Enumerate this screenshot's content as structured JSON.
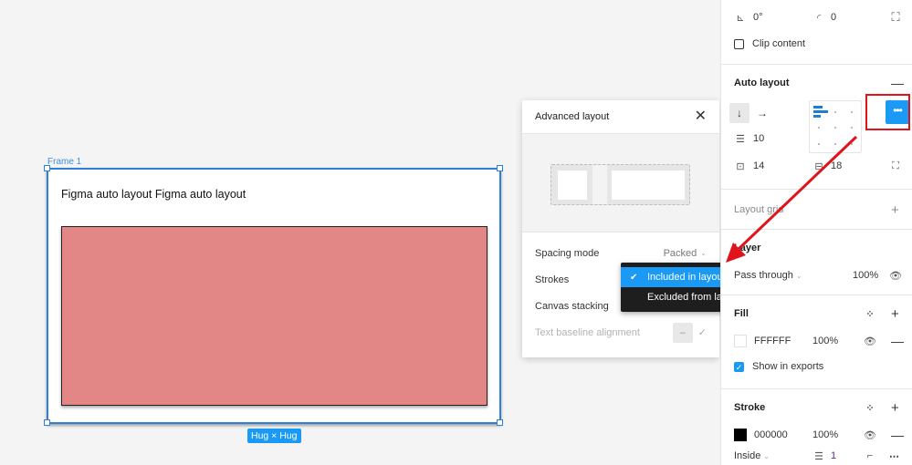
{
  "canvas": {
    "frame_label": "Frame 1",
    "frame_text": "Figma auto layout Figma auto layout",
    "hug_badge": "Hug × Hug",
    "rect_color": "#e38786"
  },
  "advanced_layout": {
    "title": "Advanced layout",
    "close_icon": "close-icon",
    "rows": [
      {
        "label": "Spacing mode",
        "value": "Packed"
      },
      {
        "label": "Strokes",
        "value": "Included in layout"
      },
      {
        "label": "Canvas stacking",
        "value": ""
      },
      {
        "label": "Text baseline alignment",
        "value": "–"
      }
    ]
  },
  "strokes_dropdown": {
    "options": [
      {
        "label": "Included in layout",
        "selected": true
      },
      {
        "label": "Excluded from layout",
        "selected": false
      }
    ]
  },
  "panel": {
    "rotation": "0°",
    "corner_radius": "0",
    "clip_content": "Clip content",
    "auto_layout": {
      "title": "Auto layout",
      "spacing": "10",
      "padding_horizontal": "14",
      "padding_vertical": "18",
      "direction_down": "↓",
      "direction_right": "→",
      "more": "•••"
    },
    "layout_grid": {
      "title": "Layout grid"
    },
    "layer": {
      "title": "Layer",
      "blend_mode": "Pass through",
      "opacity": "100%"
    },
    "fill": {
      "title": "Fill",
      "hex": "FFFFFF",
      "opacity": "100%",
      "show_in_exports": "Show in exports",
      "swatch": "#ffffff"
    },
    "stroke": {
      "title": "Stroke",
      "hex": "000000",
      "opacity": "100%",
      "position": "Inside",
      "weight": "1",
      "swatch": "#000000"
    }
  },
  "colors": {
    "accent": "#1a9af5",
    "selection": "#2f7fd6",
    "annotation_red": "#e0141a"
  }
}
